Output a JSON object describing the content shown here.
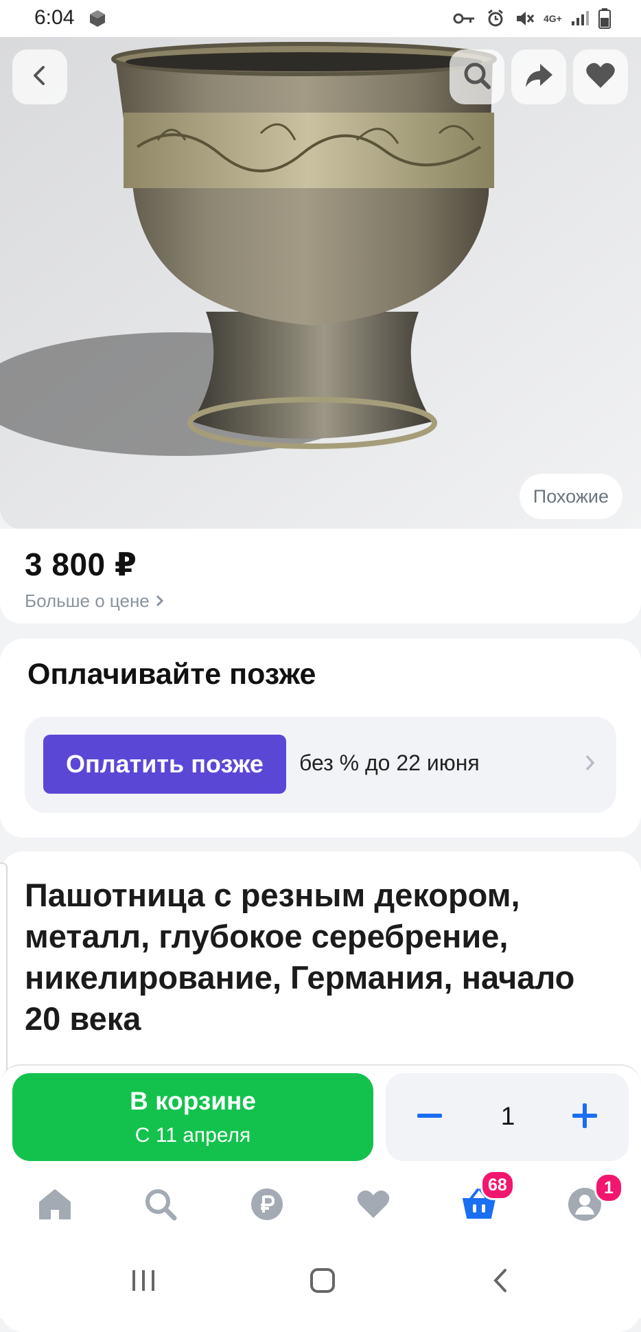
{
  "status_bar": {
    "time": "6:04",
    "network": "4G+"
  },
  "hero": {
    "image_alt": "Пашотница",
    "similar_label": "Похожие",
    "icons": [
      "back-icon",
      "search-icon",
      "share-icon",
      "heart-icon"
    ]
  },
  "price": {
    "value": "3 800 ₽",
    "more_label": "Больше о цене"
  },
  "pay_later": {
    "title": "Оплачивайте позже",
    "button_label": "Оплатить позже",
    "terms": "без % до 22 июня"
  },
  "product": {
    "title": "Пашотница с резным декором, металл, глубокое серебрение, никелирование, Германия, начало 20 века"
  },
  "cart": {
    "main_label": "В корзине",
    "sub_label": "С 11 апреля",
    "quantity": "1"
  },
  "bottom_nav": {
    "cart_badge": "68",
    "profile_badge": "1",
    "active_color": "#1a6ef2",
    "inactive_color": "#a3aab4",
    "items": [
      "home-icon",
      "search-icon",
      "ruble-icon",
      "heart-icon",
      "cart-icon",
      "profile-icon"
    ]
  },
  "colors": {
    "accent_green": "#12c24d",
    "accent_purple": "#5b47d6",
    "badge_pink": "#f2166e"
  }
}
